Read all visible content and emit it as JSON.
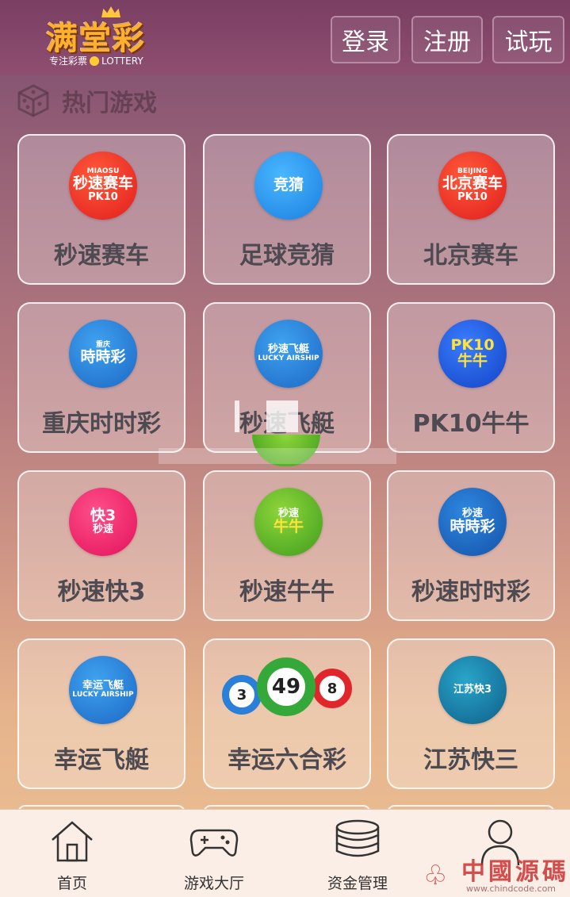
{
  "header": {
    "logo_main": "满堂彩",
    "logo_sub_left": "专注彩票",
    "logo_sub_right": "LOTTERY",
    "login_label": "登录",
    "register_label": "注册",
    "trial_label": "试玩"
  },
  "section": {
    "title": "热门游戏"
  },
  "games": [
    {
      "label": "秒速赛车",
      "badge_small": "MIAOSU",
      "badge_big": "秒速赛车",
      "badge_mid": "PK10",
      "color": "#e11d1d"
    },
    {
      "label": "足球竞猜",
      "badge_small": "",
      "badge_big": "竞猜",
      "badge_mid": "",
      "color": "#1b7fe0"
    },
    {
      "label": "北京赛车",
      "badge_small": "BEIJING",
      "badge_big": "北京赛车",
      "badge_mid": "PK10",
      "color": "#e11d1d"
    },
    {
      "label": "重庆时时彩",
      "badge_small": "重庆",
      "badge_big": "時時彩",
      "badge_mid": "",
      "color": "#1c68c4"
    },
    {
      "label": "秒速飞艇",
      "badge_small": "",
      "badge_big": "秒速飞艇",
      "badge_mid": "LUCKY AIRSHIP",
      "color": "#1c68c4"
    },
    {
      "label": "PK10牛牛",
      "badge_small": "",
      "badge_big": "PK10",
      "badge_mid": "牛牛",
      "color": "#1243c4"
    },
    {
      "label": "秒速快3",
      "badge_small": "",
      "badge_big": "快3",
      "badge_mid": "秒速",
      "color": "#e3115a"
    },
    {
      "label": "秒速牛牛",
      "badge_small": "",
      "badge_big": "秒速",
      "badge_mid": "牛牛",
      "color": "#3e9d1c"
    },
    {
      "label": "秒速时时彩",
      "badge_small": "秒速",
      "badge_big": "時時彩",
      "badge_mid": "",
      "color": "#1552a8"
    },
    {
      "label": "幸运飞艇",
      "badge_small": "",
      "badge_big": "幸运飞艇",
      "badge_mid": "LUCKY AIRSHIP",
      "color": "#1c68c4"
    },
    {
      "label": "幸运六合彩",
      "balls": [
        "3",
        "49",
        "8"
      ]
    },
    {
      "label": "江苏快三",
      "badge_small": "",
      "badge_big": "江苏快3",
      "badge_mid": "",
      "color": "#0f5f8a"
    }
  ],
  "bottom_nav": [
    {
      "label": "首页",
      "icon": "home-icon"
    },
    {
      "label": "游戏大厅",
      "icon": "gamepad-icon"
    },
    {
      "label": "资金管理",
      "icon": "coins-icon"
    },
    {
      "label": "",
      "icon": "user-icon"
    }
  ],
  "watermark": {
    "text": "中國源碼",
    "url": "www.chindcode.com"
  }
}
